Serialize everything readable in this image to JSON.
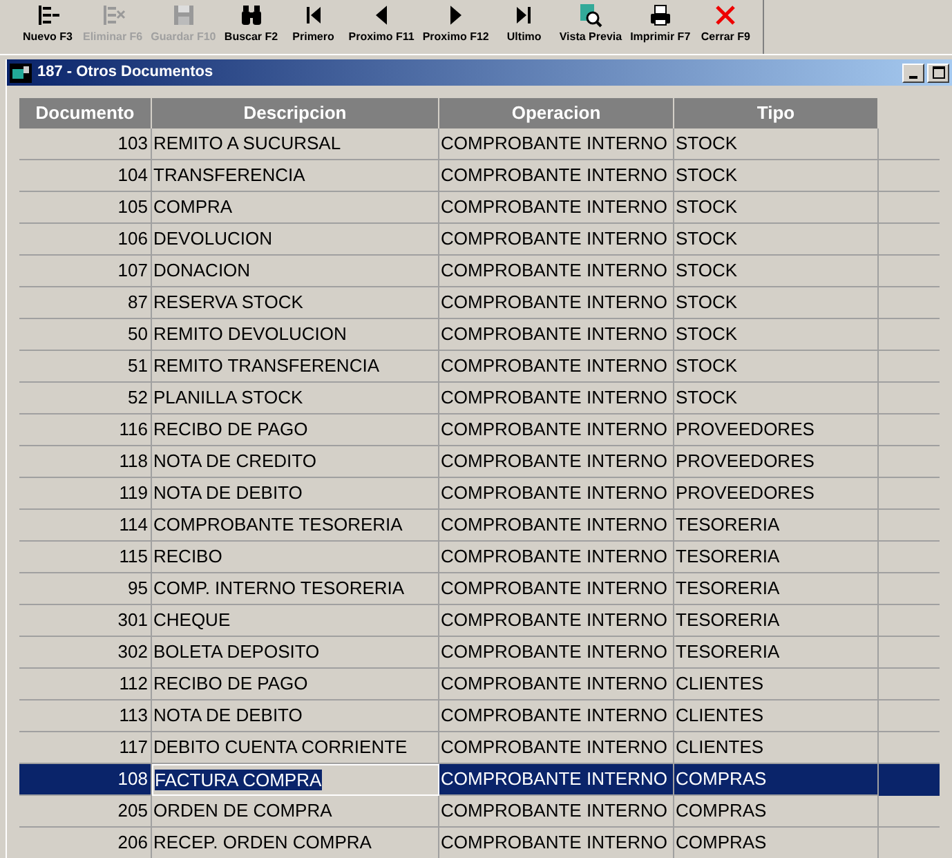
{
  "toolbar": [
    {
      "kind": "new",
      "label": "Nuevo F3",
      "disabled": false
    },
    {
      "kind": "delete",
      "label": "Eliminar F6",
      "disabled": true
    },
    {
      "kind": "save",
      "label": "Guardar F10",
      "disabled": true
    },
    {
      "kind": "find",
      "label": "Buscar F2",
      "disabled": false
    },
    {
      "kind": "first",
      "label": "Primero",
      "disabled": false
    },
    {
      "kind": "prev",
      "label": "Proximo F11",
      "disabled": false
    },
    {
      "kind": "next",
      "label": "Proximo F12",
      "disabled": false
    },
    {
      "kind": "last",
      "label": "Ultimo",
      "disabled": false
    },
    {
      "kind": "preview",
      "label": "Vista Previa",
      "disabled": false
    },
    {
      "kind": "print",
      "label": "Imprimir F7",
      "disabled": false
    },
    {
      "kind": "close",
      "label": "Cerrar F9",
      "disabled": false
    }
  ],
  "window": {
    "title": "187 - Otros Documentos"
  },
  "table": {
    "columns": [
      "Documento",
      "Descripcion",
      "Operacion",
      "Tipo"
    ],
    "rows": [
      {
        "documento": "103",
        "descripcion": "REMITO A SUCURSAL",
        "operacion": "COMPROBANTE INTERNO",
        "tipo": "STOCK",
        "selected": false
      },
      {
        "documento": "104",
        "descripcion": "TRANSFERENCIA",
        "operacion": "COMPROBANTE INTERNO",
        "tipo": "STOCK",
        "selected": false
      },
      {
        "documento": "105",
        "descripcion": "COMPRA",
        "operacion": "COMPROBANTE INTERNO",
        "tipo": "STOCK",
        "selected": false
      },
      {
        "documento": "106",
        "descripcion": "DEVOLUCION",
        "operacion": "COMPROBANTE INTERNO",
        "tipo": "STOCK",
        "selected": false
      },
      {
        "documento": "107",
        "descripcion": "DONACION",
        "operacion": "COMPROBANTE INTERNO",
        "tipo": "STOCK",
        "selected": false
      },
      {
        "documento": "87",
        "descripcion": "RESERVA STOCK",
        "operacion": "COMPROBANTE INTERNO",
        "tipo": "STOCK",
        "selected": false
      },
      {
        "documento": "50",
        "descripcion": "REMITO DEVOLUCION",
        "operacion": "COMPROBANTE INTERNO",
        "tipo": "STOCK",
        "selected": false
      },
      {
        "documento": "51",
        "descripcion": "REMITO TRANSFERENCIA",
        "operacion": "COMPROBANTE INTERNO",
        "tipo": "STOCK",
        "selected": false
      },
      {
        "documento": "52",
        "descripcion": "PLANILLA STOCK",
        "operacion": "COMPROBANTE INTERNO",
        "tipo": "STOCK",
        "selected": false
      },
      {
        "documento": "116",
        "descripcion": "RECIBO DE PAGO",
        "operacion": "COMPROBANTE INTERNO",
        "tipo": "PROVEEDORES",
        "selected": false
      },
      {
        "documento": "118",
        "descripcion": "NOTA DE CREDITO",
        "operacion": "COMPROBANTE INTERNO",
        "tipo": "PROVEEDORES",
        "selected": false
      },
      {
        "documento": "119",
        "descripcion": "NOTA DE DEBITO",
        "operacion": "COMPROBANTE INTERNO",
        "tipo": "PROVEEDORES",
        "selected": false
      },
      {
        "documento": "114",
        "descripcion": "COMPROBANTE TESORERIA",
        "operacion": "COMPROBANTE INTERNO",
        "tipo": "TESORERIA",
        "selected": false
      },
      {
        "documento": "115",
        "descripcion": "RECIBO",
        "operacion": "COMPROBANTE INTERNO",
        "tipo": "TESORERIA",
        "selected": false
      },
      {
        "documento": "95",
        "descripcion": "COMP. INTERNO TESORERIA",
        "operacion": "COMPROBANTE INTERNO",
        "tipo": "TESORERIA",
        "selected": false
      },
      {
        "documento": "301",
        "descripcion": "CHEQUE",
        "operacion": "COMPROBANTE INTERNO",
        "tipo": "TESORERIA",
        "selected": false
      },
      {
        "documento": "302",
        "descripcion": "BOLETA DEPOSITO",
        "operacion": "COMPROBANTE INTERNO",
        "tipo": "TESORERIA",
        "selected": false
      },
      {
        "documento": "112",
        "descripcion": "RECIBO DE PAGO",
        "operacion": "COMPROBANTE INTERNO",
        "tipo": "CLIENTES",
        "selected": false
      },
      {
        "documento": "113",
        "descripcion": "NOTA DE DEBITO",
        "operacion": "COMPROBANTE INTERNO",
        "tipo": "CLIENTES",
        "selected": false
      },
      {
        "documento": "117",
        "descripcion": "DEBITO CUENTA CORRIENTE",
        "operacion": "COMPROBANTE INTERNO",
        "tipo": "CLIENTES",
        "selected": false
      },
      {
        "documento": "108",
        "descripcion": "FACTURA COMPRA",
        "operacion": "COMPROBANTE INTERNO",
        "tipo": "COMPRAS",
        "selected": true
      },
      {
        "documento": "205",
        "descripcion": "ORDEN DE COMPRA",
        "operacion": "COMPROBANTE INTERNO",
        "tipo": "COMPRAS",
        "selected": false
      },
      {
        "documento": "206",
        "descripcion": "RECEP. ORDEN COMPRA",
        "operacion": "COMPROBANTE INTERNO",
        "tipo": "COMPRAS",
        "selected": false
      }
    ]
  }
}
